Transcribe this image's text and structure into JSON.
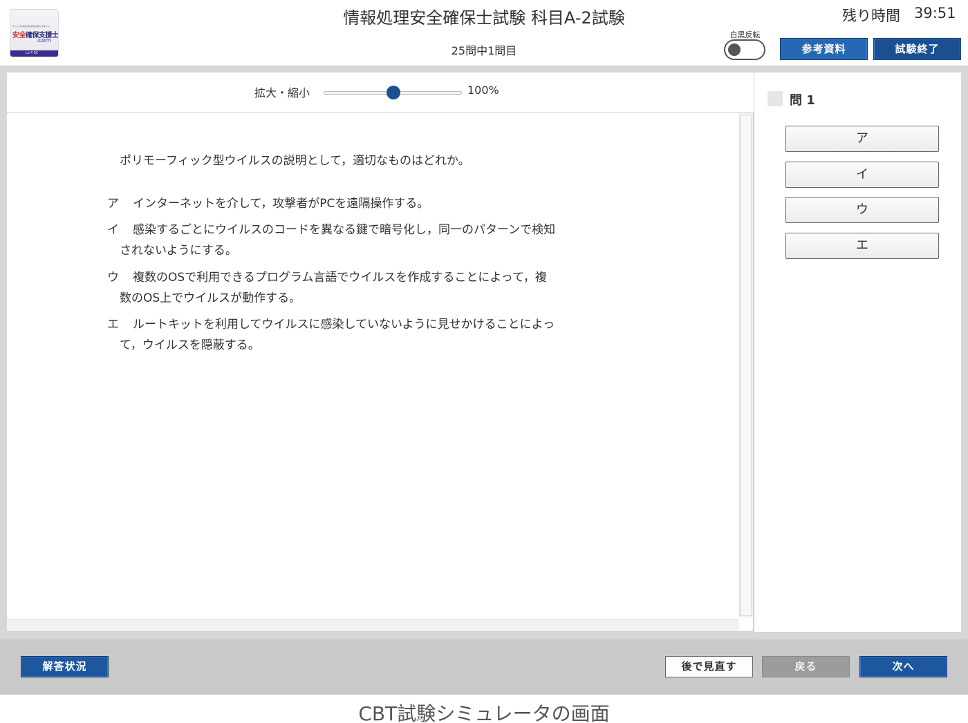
{
  "header": {
    "logo": {
      "tagline": "すべての情報処理技術者試験を応援する",
      "name_accent": "安全",
      "name_rest": "確保支援士",
      "domain": ".com",
      "badge": "Lv.4  SC"
    },
    "title": "情報処理安全確保士試験 科目A-2試験",
    "progress": "25問中1問目",
    "timer_label": "残り時間",
    "timer_value": "39:51",
    "invert_label": "白黒反転",
    "invert_on": false,
    "reference_button": "参考資料",
    "finish_button": "試験終了"
  },
  "zoom": {
    "label": "拡大・縮小",
    "value": "100%",
    "level_percent": 100
  },
  "question": {
    "stem": "ポリモーフィック型ウイルスの説明として，適切なものはどれか。",
    "options": [
      {
        "mark": "ア",
        "line1": "インターネットを介して，攻撃者がPCを遠隔操作する。",
        "line2": ""
      },
      {
        "mark": "イ",
        "line1": "感染するごとにウイルスのコードを異なる鍵で暗号化し，同一のパターンで検知",
        "line2": "されないようにする。"
      },
      {
        "mark": "ウ",
        "line1": "複数のOSで利用できるプログラム言語でウイルスを作成することによって，複",
        "line2": "数のOS上でウイルスが動作する。"
      },
      {
        "mark": "エ",
        "line1": "ルートキットを利用してウイルスに感染していないように見せかけることによっ",
        "line2": "て，ウイルスを隠蔽する。"
      }
    ]
  },
  "answer_panel": {
    "question_label": "問 1",
    "choices": [
      "ア",
      "イ",
      "ウ",
      "エ"
    ]
  },
  "footer": {
    "status_button": "解答状況",
    "review_button": "後で見直す",
    "back_button": "戻る",
    "next_button": "次へ"
  },
  "caption": "CBT試験シミュレータの画面",
  "colors": {
    "primary_button": "#1f5ca8",
    "disabled_button": "#9c9c9c",
    "footer_bg": "#c9c9c9",
    "slider_knob": "#1b4f8f"
  }
}
